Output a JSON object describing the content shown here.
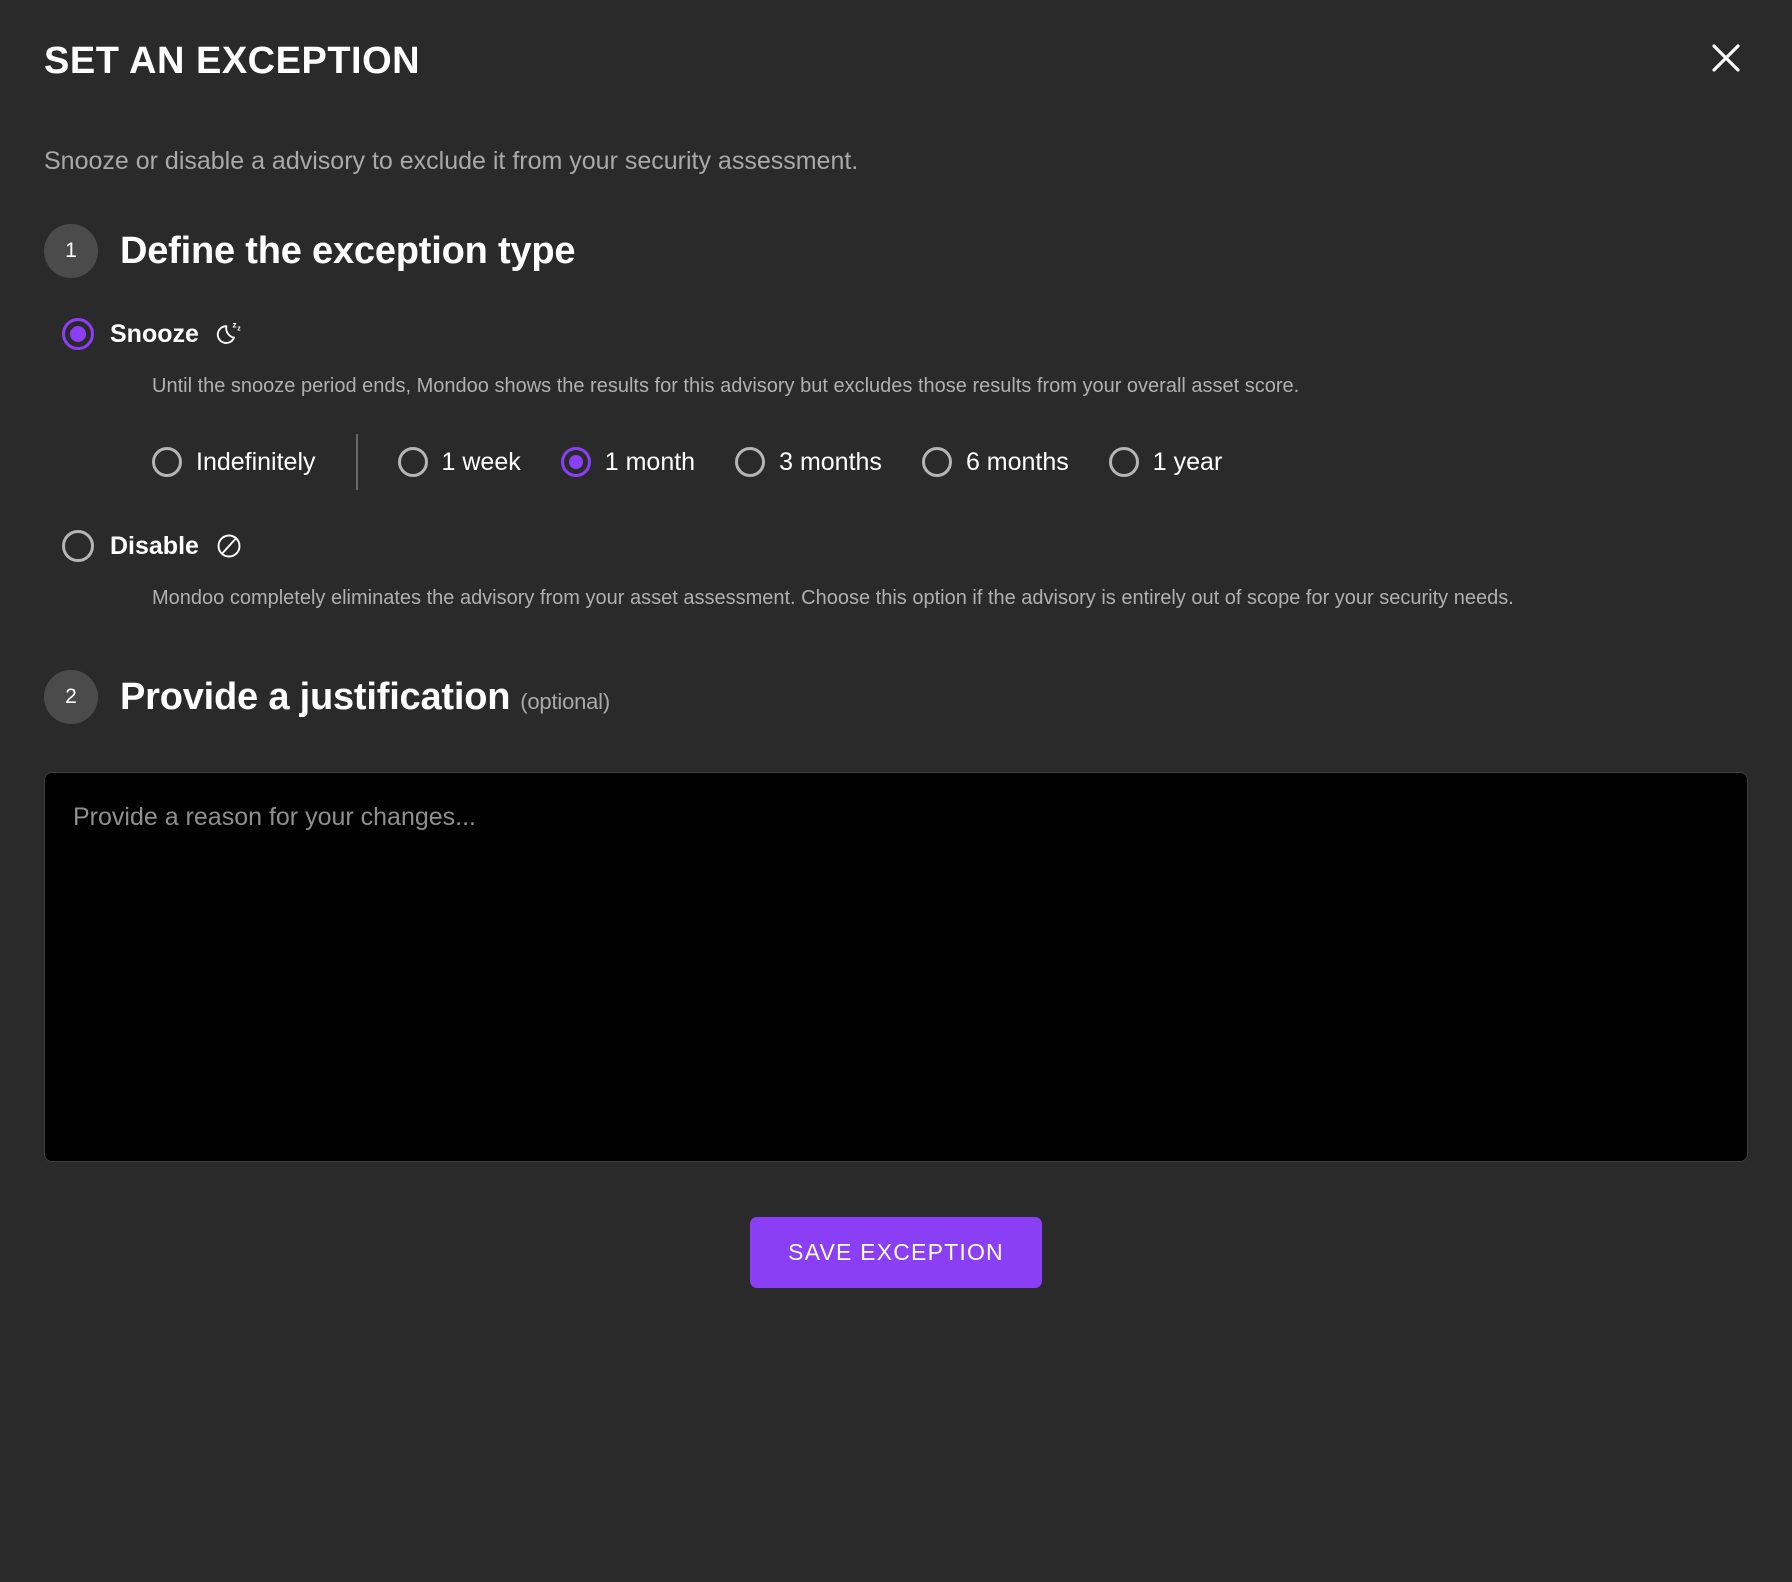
{
  "colors": {
    "background": "#2a2a2a",
    "accent_purple": "#8b3ff5",
    "badge_grey": "#4b4b4b",
    "muted_text": "#a9a9a9",
    "textarea_background": "#000000",
    "top_strip": "#2b1f44"
  },
  "header": {
    "title": "SET AN EXCEPTION",
    "subtitle": "Snooze or disable a advisory to exclude it from your security assessment.",
    "close_icon": "close-icon"
  },
  "step1": {
    "number": "1",
    "title": "Define the exception type",
    "options": [
      {
        "id": "snooze",
        "label": "Snooze",
        "icon": "moon-zzz-icon",
        "selected": true,
        "description": "Until the snooze period ends, Mondoo shows the results for this advisory but excludes those results from your overall asset score."
      },
      {
        "id": "disable",
        "label": "Disable",
        "icon": "prohibited-icon",
        "selected": false,
        "description": "Mondoo completely eliminates the advisory from your asset assessment. Choose this option if the advisory is entirely out of scope for your security needs."
      }
    ],
    "durations": [
      {
        "id": "indefinitely",
        "label": "Indefinitely",
        "selected": false
      },
      {
        "id": "1-week",
        "label": "1 week",
        "selected": false
      },
      {
        "id": "1-month",
        "label": "1 month",
        "selected": true
      },
      {
        "id": "3-months",
        "label": "3 months",
        "selected": false
      },
      {
        "id": "6-months",
        "label": "6 months",
        "selected": false
      },
      {
        "id": "1-year",
        "label": "1 year",
        "selected": false
      }
    ]
  },
  "step2": {
    "number": "2",
    "title": "Provide a justification",
    "optional_label": "(optional)",
    "justification": {
      "value": "",
      "placeholder": "Provide a reason for your changes..."
    }
  },
  "footer": {
    "save_label": "SAVE EXCEPTION"
  }
}
